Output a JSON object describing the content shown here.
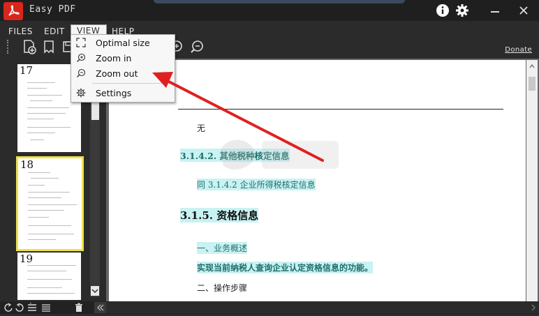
{
  "app": {
    "title": "Easy PDF"
  },
  "menubar": {
    "files": "FILES",
    "edit": "EDIT",
    "view": "VIEW",
    "help": "HELP"
  },
  "toolbar": {
    "donate": "Donate"
  },
  "view_menu": {
    "items": [
      {
        "label": "Optimal size",
        "icon": "fit-icon"
      },
      {
        "label": "Zoom in",
        "icon": "zoom-in-icon"
      },
      {
        "label": "Zoom out",
        "icon": "zoom-out-icon"
      },
      {
        "label": "Settings",
        "icon": "gear-icon"
      }
    ]
  },
  "thumbnails": [
    {
      "page": "17"
    },
    {
      "page": "18",
      "selected": true
    },
    {
      "page": "19"
    }
  ],
  "document": {
    "line1": "无",
    "heading1": "3.1.4.2. 其他税种核定信息",
    "line2": "同 3.1.4.2 企业所得税核定信息",
    "heading2": "3.1.5. 资格信息",
    "line3": "一、业务概述",
    "line4": "实现当前纳税人查询企业认定资格信息的功能。",
    "line5": "二、操作步骤"
  },
  "colors": {
    "accent": "#d9261c",
    "highlight": "#c9f2f2",
    "teal_text": "#1d6e6b",
    "selected_thumb_border": "#f0e04a",
    "annotation_arrow": "#e02020"
  }
}
